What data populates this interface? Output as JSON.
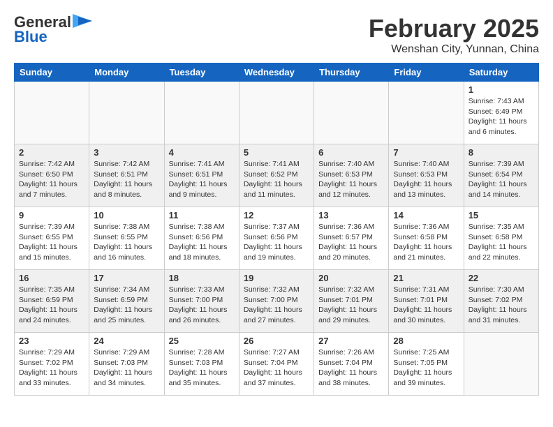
{
  "header": {
    "logo_line1": "General",
    "logo_line2": "Blue",
    "month": "February 2025",
    "location": "Wenshan City, Yunnan, China"
  },
  "weekdays": [
    "Sunday",
    "Monday",
    "Tuesday",
    "Wednesday",
    "Thursday",
    "Friday",
    "Saturday"
  ],
  "weeks": [
    [
      {
        "day": "",
        "info": ""
      },
      {
        "day": "",
        "info": ""
      },
      {
        "day": "",
        "info": ""
      },
      {
        "day": "",
        "info": ""
      },
      {
        "day": "",
        "info": ""
      },
      {
        "day": "",
        "info": ""
      },
      {
        "day": "1",
        "info": "Sunrise: 7:43 AM\nSunset: 6:49 PM\nDaylight: 11 hours and 6 minutes."
      }
    ],
    [
      {
        "day": "2",
        "info": "Sunrise: 7:42 AM\nSunset: 6:50 PM\nDaylight: 11 hours and 7 minutes."
      },
      {
        "day": "3",
        "info": "Sunrise: 7:42 AM\nSunset: 6:51 PM\nDaylight: 11 hours and 8 minutes."
      },
      {
        "day": "4",
        "info": "Sunrise: 7:41 AM\nSunset: 6:51 PM\nDaylight: 11 hours and 9 minutes."
      },
      {
        "day": "5",
        "info": "Sunrise: 7:41 AM\nSunset: 6:52 PM\nDaylight: 11 hours and 11 minutes."
      },
      {
        "day": "6",
        "info": "Sunrise: 7:40 AM\nSunset: 6:53 PM\nDaylight: 11 hours and 12 minutes."
      },
      {
        "day": "7",
        "info": "Sunrise: 7:40 AM\nSunset: 6:53 PM\nDaylight: 11 hours and 13 minutes."
      },
      {
        "day": "8",
        "info": "Sunrise: 7:39 AM\nSunset: 6:54 PM\nDaylight: 11 hours and 14 minutes."
      }
    ],
    [
      {
        "day": "9",
        "info": "Sunrise: 7:39 AM\nSunset: 6:55 PM\nDaylight: 11 hours and 15 minutes."
      },
      {
        "day": "10",
        "info": "Sunrise: 7:38 AM\nSunset: 6:55 PM\nDaylight: 11 hours and 16 minutes."
      },
      {
        "day": "11",
        "info": "Sunrise: 7:38 AM\nSunset: 6:56 PM\nDaylight: 11 hours and 18 minutes."
      },
      {
        "day": "12",
        "info": "Sunrise: 7:37 AM\nSunset: 6:56 PM\nDaylight: 11 hours and 19 minutes."
      },
      {
        "day": "13",
        "info": "Sunrise: 7:36 AM\nSunset: 6:57 PM\nDaylight: 11 hours and 20 minutes."
      },
      {
        "day": "14",
        "info": "Sunrise: 7:36 AM\nSunset: 6:58 PM\nDaylight: 11 hours and 21 minutes."
      },
      {
        "day": "15",
        "info": "Sunrise: 7:35 AM\nSunset: 6:58 PM\nDaylight: 11 hours and 22 minutes."
      }
    ],
    [
      {
        "day": "16",
        "info": "Sunrise: 7:35 AM\nSunset: 6:59 PM\nDaylight: 11 hours and 24 minutes."
      },
      {
        "day": "17",
        "info": "Sunrise: 7:34 AM\nSunset: 6:59 PM\nDaylight: 11 hours and 25 minutes."
      },
      {
        "day": "18",
        "info": "Sunrise: 7:33 AM\nSunset: 7:00 PM\nDaylight: 11 hours and 26 minutes."
      },
      {
        "day": "19",
        "info": "Sunrise: 7:32 AM\nSunset: 7:00 PM\nDaylight: 11 hours and 27 minutes."
      },
      {
        "day": "20",
        "info": "Sunrise: 7:32 AM\nSunset: 7:01 PM\nDaylight: 11 hours and 29 minutes."
      },
      {
        "day": "21",
        "info": "Sunrise: 7:31 AM\nSunset: 7:01 PM\nDaylight: 11 hours and 30 minutes."
      },
      {
        "day": "22",
        "info": "Sunrise: 7:30 AM\nSunset: 7:02 PM\nDaylight: 11 hours and 31 minutes."
      }
    ],
    [
      {
        "day": "23",
        "info": "Sunrise: 7:29 AM\nSunset: 7:02 PM\nDaylight: 11 hours and 33 minutes."
      },
      {
        "day": "24",
        "info": "Sunrise: 7:29 AM\nSunset: 7:03 PM\nDaylight: 11 hours and 34 minutes."
      },
      {
        "day": "25",
        "info": "Sunrise: 7:28 AM\nSunset: 7:03 PM\nDaylight: 11 hours and 35 minutes."
      },
      {
        "day": "26",
        "info": "Sunrise: 7:27 AM\nSunset: 7:04 PM\nDaylight: 11 hours and 37 minutes."
      },
      {
        "day": "27",
        "info": "Sunrise: 7:26 AM\nSunset: 7:04 PM\nDaylight: 11 hours and 38 minutes."
      },
      {
        "day": "28",
        "info": "Sunrise: 7:25 AM\nSunset: 7:05 PM\nDaylight: 11 hours and 39 minutes."
      },
      {
        "day": "",
        "info": ""
      }
    ]
  ]
}
